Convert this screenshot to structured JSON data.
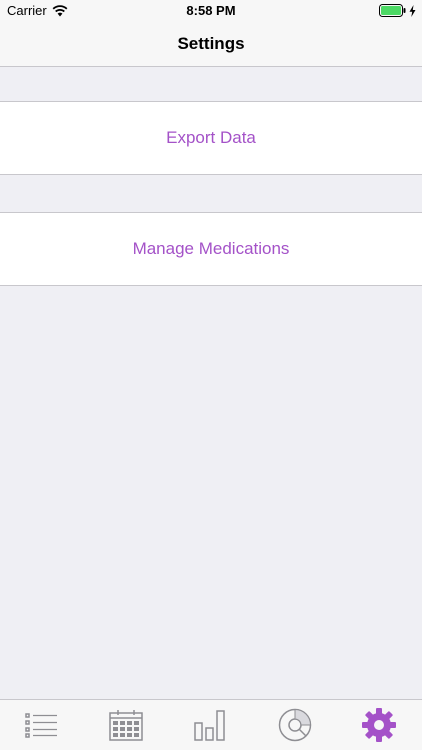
{
  "status_bar": {
    "carrier": "Carrier",
    "time": "8:58 PM",
    "battery_color": "#4cd964"
  },
  "nav": {
    "title": "Settings"
  },
  "settings": {
    "export_label": "Export Data",
    "medications_label": "Manage Medications"
  },
  "colors": {
    "accent": "#a452c8",
    "tab_inactive": "#8e8e93"
  },
  "tabs": [
    {
      "icon": "list-icon",
      "selected": false
    },
    {
      "icon": "calendar-icon",
      "selected": false
    },
    {
      "icon": "bar-chart-icon",
      "selected": false
    },
    {
      "icon": "pie-chart-icon",
      "selected": false
    },
    {
      "icon": "gear-icon",
      "selected": true
    }
  ]
}
